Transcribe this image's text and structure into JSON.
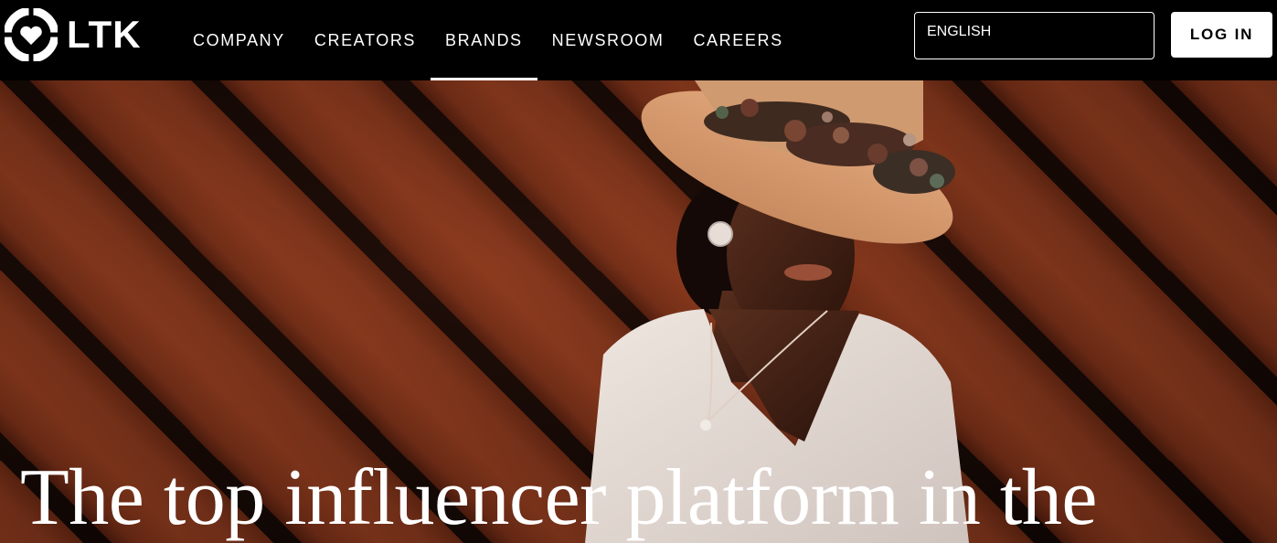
{
  "header": {
    "logo_text": "LTK",
    "nav": [
      {
        "label": "COMPANY"
      },
      {
        "label": "CREATORS"
      },
      {
        "label": "BRANDS"
      },
      {
        "label": "NEWSROOM"
      },
      {
        "label": "CAREERS"
      }
    ],
    "active_nav": "BRANDS",
    "language": "ENGLISH",
    "login_label": "LOG IN"
  },
  "hero": {
    "headline": "The top influencer platform in the",
    "image": "woman-in-straw-hat-against-diagonal-wood-wall"
  },
  "colors": {
    "nav_bg": "#000000",
    "hero_wood": "#7a321a",
    "text": "#ffffff"
  }
}
